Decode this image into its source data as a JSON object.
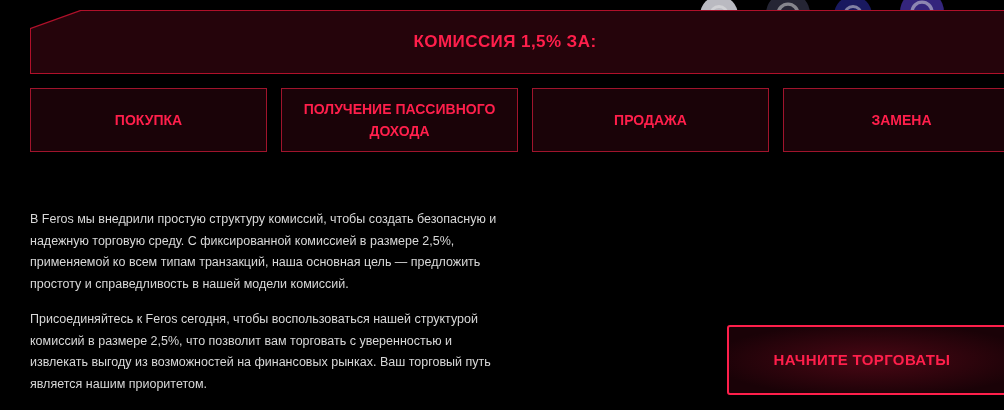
{
  "header": {
    "title": "КОМИССИЯ 1,5% ЗА:"
  },
  "fee_cards": [
    {
      "label": "ПОКУПКА"
    },
    {
      "label": "ПОЛУЧЕНИЕ ПАССИВНОГО ДОХОДА"
    },
    {
      "label": "ПРОДАЖА"
    },
    {
      "label": "ЗАМЕНА"
    }
  ],
  "paragraphs": [
    "В Feros мы внедрили простую структуру комиссий, чтобы создать безопасную и надежную торговую среду. С фиксированной комиссией в размере 2,5%, применяемой ко всем типам транзакций, наша основная цель — предложить простоту и справедливость в нашей модели комиссий.",
    "Присоединяйтесь к Feros сегодня, чтобы воспользоваться нашей структурой комиссий в размере 2,5%, что позволит вам торговать с уверенностью и извлекать выгоду из возможностей на финансовых рынках. Ваш торговый путь является нашим приоритетом."
  ],
  "cta_button": {
    "label": "НАЧНИТЕ ТОРГОВАТЫ"
  }
}
